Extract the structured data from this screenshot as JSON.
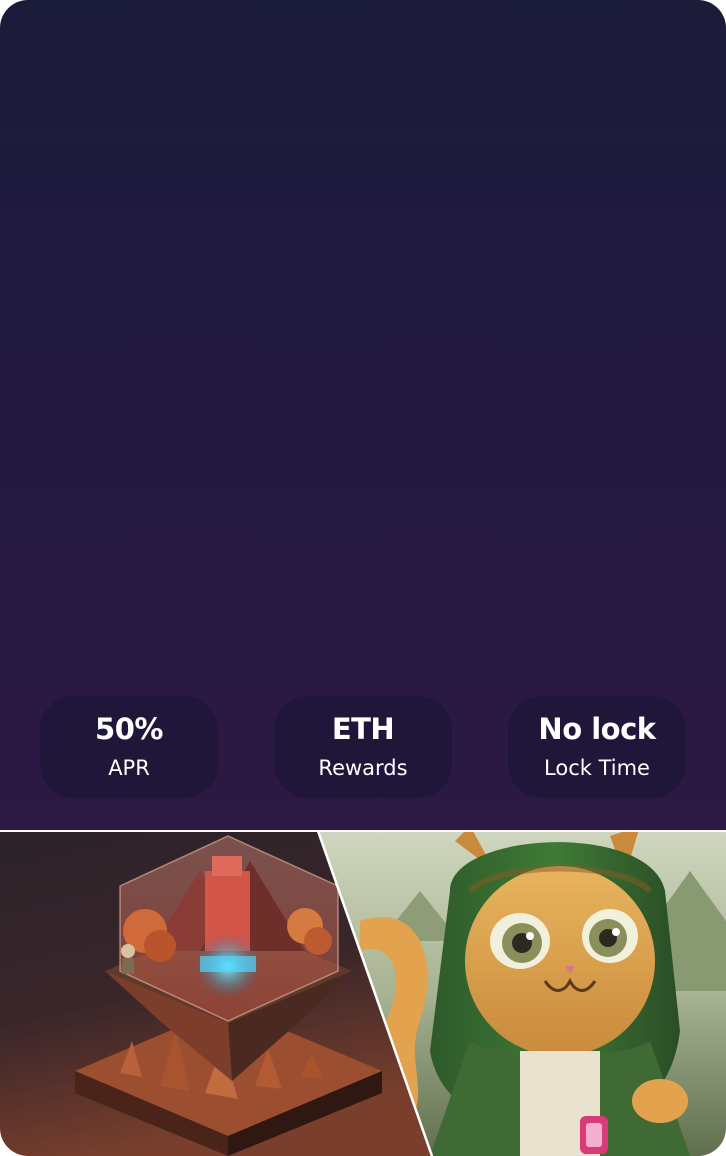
{
  "stats": [
    {
      "value": "50%",
      "label": "APR"
    },
    {
      "value": "ETH",
      "label": "Rewards"
    },
    {
      "value": "No lock",
      "label": "Lock Time"
    }
  ],
  "artwork": [
    {
      "icon": "isometric-island-artwork"
    },
    {
      "icon": "cat-artwork"
    }
  ],
  "colors": {
    "panel_top": "#1b1b3a",
    "panel_bottom": "#2c1944",
    "stat_pill": "#1c1637",
    "stat_text": "#ffffff"
  }
}
